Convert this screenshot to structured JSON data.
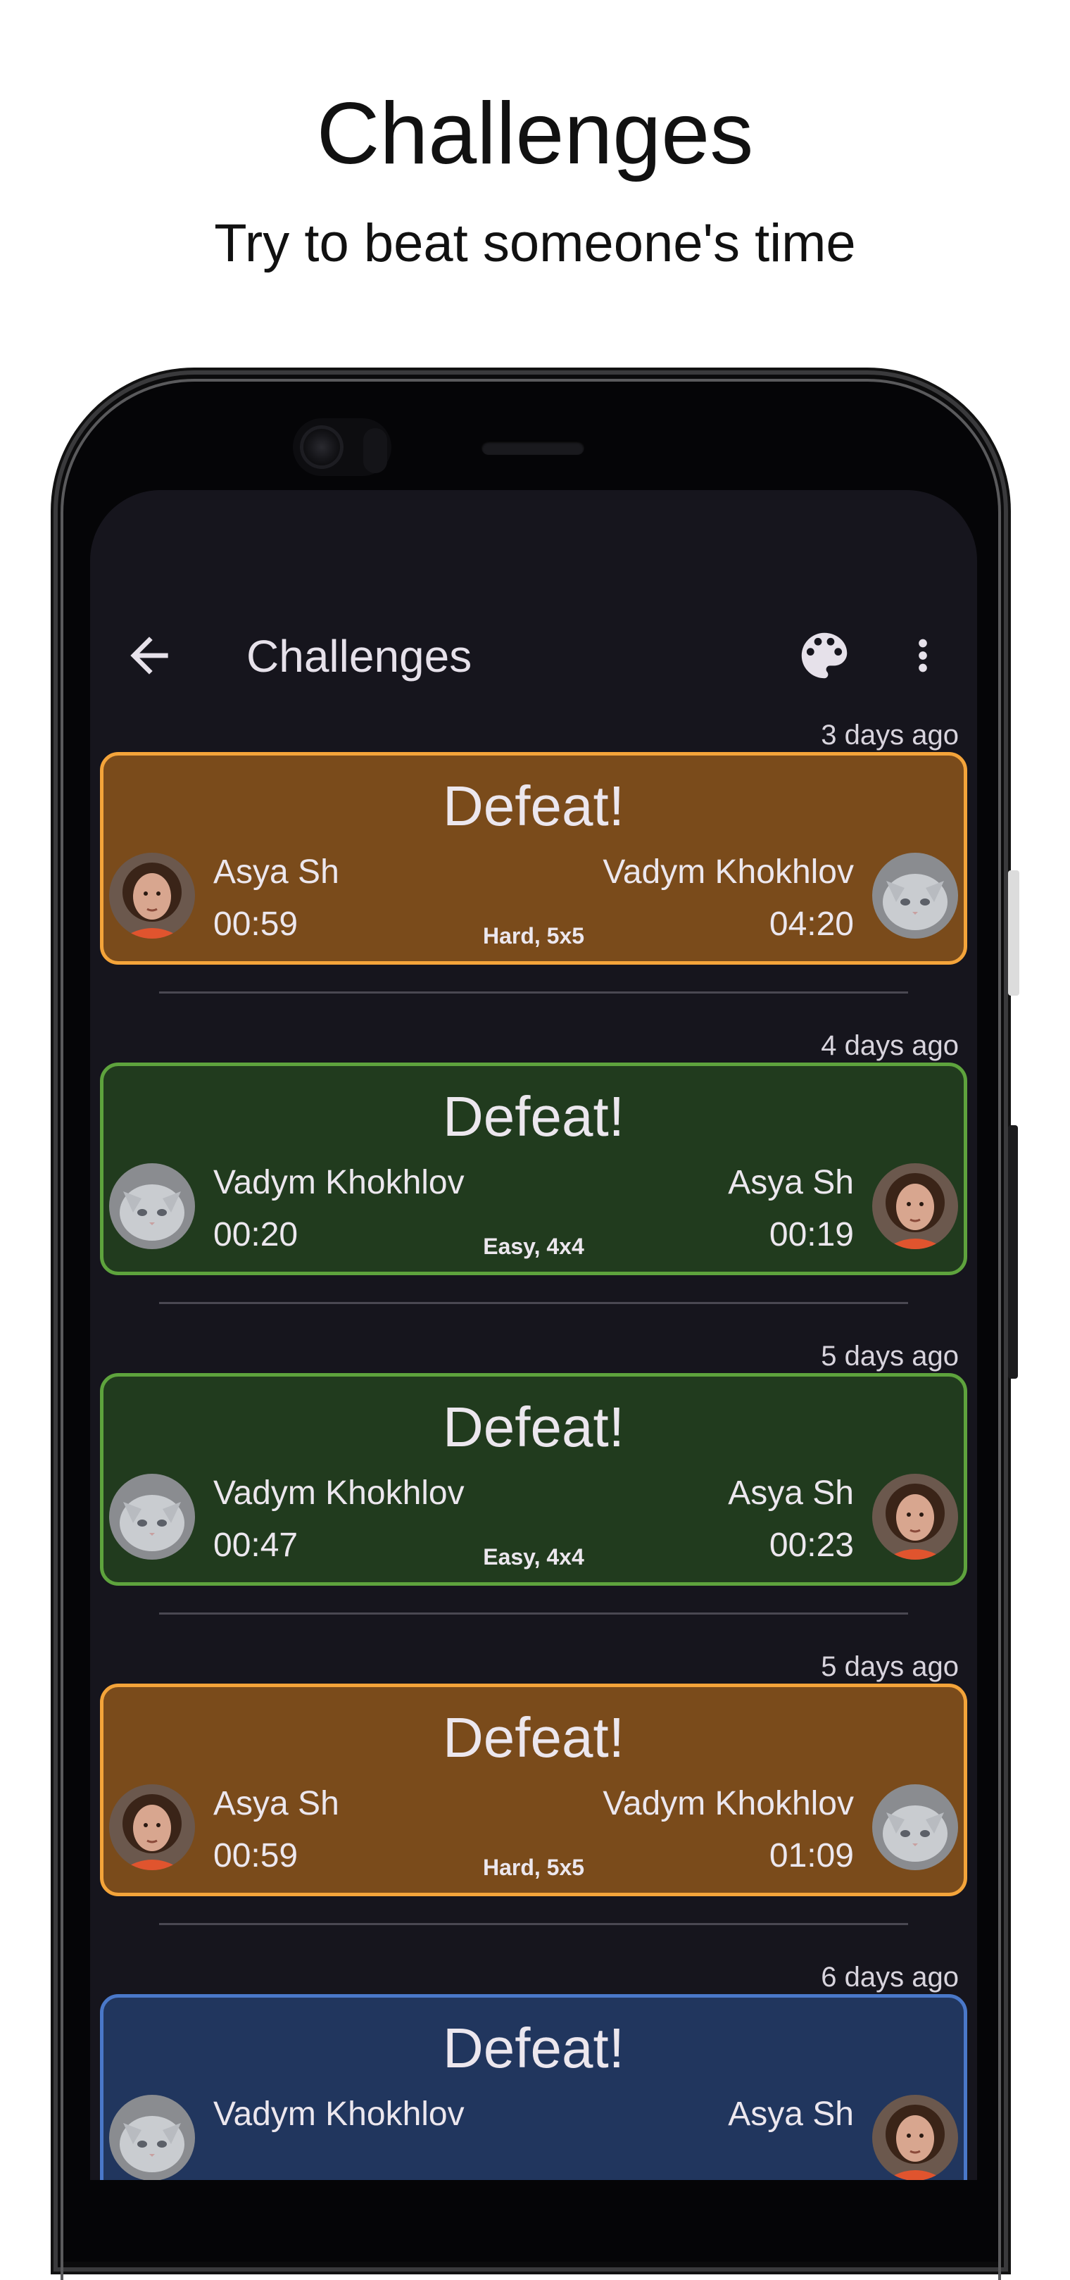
{
  "promo": {
    "title": "Challenges",
    "subtitle": "Try to beat someone's time"
  },
  "appbar": {
    "title": "Challenges",
    "back_icon": "arrow-back-icon",
    "palette_icon": "palette-icon",
    "more_icon": "more-vert-icon"
  },
  "colors": {
    "background": "#16151d",
    "hard_card": "#7a4b1b",
    "hard_border": "#f4a43a",
    "easy_card": "#213b1e",
    "easy_border": "#5ea33d",
    "blue_card": "#21365e",
    "blue_border": "#4a78c9"
  },
  "challenges": [
    {
      "date": "3 days ago",
      "result": "Defeat!",
      "left": {
        "name": "Asya Sh",
        "time": "00:59",
        "avatar": "woman-avatar"
      },
      "right": {
        "name": "Vadym Khokhlov",
        "time": "04:20",
        "avatar": "cat-avatar"
      },
      "mode": "Hard, 5x5"
    },
    {
      "date": "4 days ago",
      "result": "Defeat!",
      "left": {
        "name": "Vadym Khokhlov",
        "time": "00:20",
        "avatar": "cat-avatar"
      },
      "right": {
        "name": "Asya Sh",
        "time": "00:19",
        "avatar": "woman-avatar"
      },
      "mode": "Easy, 4x4"
    },
    {
      "date": "5 days ago",
      "result": "Defeat!",
      "left": {
        "name": "Vadym Khokhlov",
        "time": "00:47",
        "avatar": "cat-avatar"
      },
      "right": {
        "name": "Asya Sh",
        "time": "00:23",
        "avatar": "woman-avatar"
      },
      "mode": "Easy, 4x4"
    },
    {
      "date": "5 days ago",
      "result": "Defeat!",
      "left": {
        "name": "Asya Sh",
        "time": "00:59",
        "avatar": "woman-avatar"
      },
      "right": {
        "name": "Vadym Khokhlov",
        "time": "01:09",
        "avatar": "cat-avatar"
      },
      "mode": "Hard, 5x5"
    },
    {
      "date": "6 days ago",
      "result": "Defeat!",
      "left": {
        "name": "Vadym Khokhlov",
        "time": "",
        "avatar": "cat-avatar"
      },
      "right": {
        "name": "Asya Sh",
        "time": "",
        "avatar": "woman-avatar"
      },
      "mode": ""
    }
  ]
}
